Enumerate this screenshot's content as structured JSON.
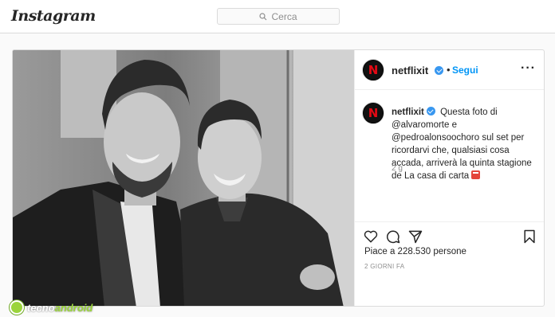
{
  "app": {
    "name": "Instagram"
  },
  "search": {
    "placeholder": "Cerca"
  },
  "post": {
    "photo_alt": "Foto di due uomini sorridenti",
    "account": {
      "username": "netflixit",
      "verified": true,
      "follow_label": "Segui",
      "avatar_letter": "N"
    },
    "caption": {
      "username": "netflixit",
      "text": "Questa foto di @alvaromorte e @pedroalonsoochoro sul set per ricordarvi che, qualsiasi cosa accada, arriverà la quinta stagione de La casa di carta"
    },
    "age": "2 g",
    "likes": "Piace a 228.530 persone",
    "date": "2 GIORNI FA"
  },
  "icons": {
    "search": "search-icon",
    "verified": "verified-icon",
    "more": "more-options-icon",
    "like": "heart-icon",
    "comment": "comment-icon",
    "share": "share-icon",
    "save": "bookmark-icon"
  },
  "watermark": {
    "text_main": "tecno",
    "text_accent": "android"
  },
  "colors": {
    "link_blue": "#0095f6",
    "verified_blue": "#3897f0",
    "netflix_red": "#e50914",
    "border": "#dbdbdb",
    "muted": "#8e8e8e"
  }
}
